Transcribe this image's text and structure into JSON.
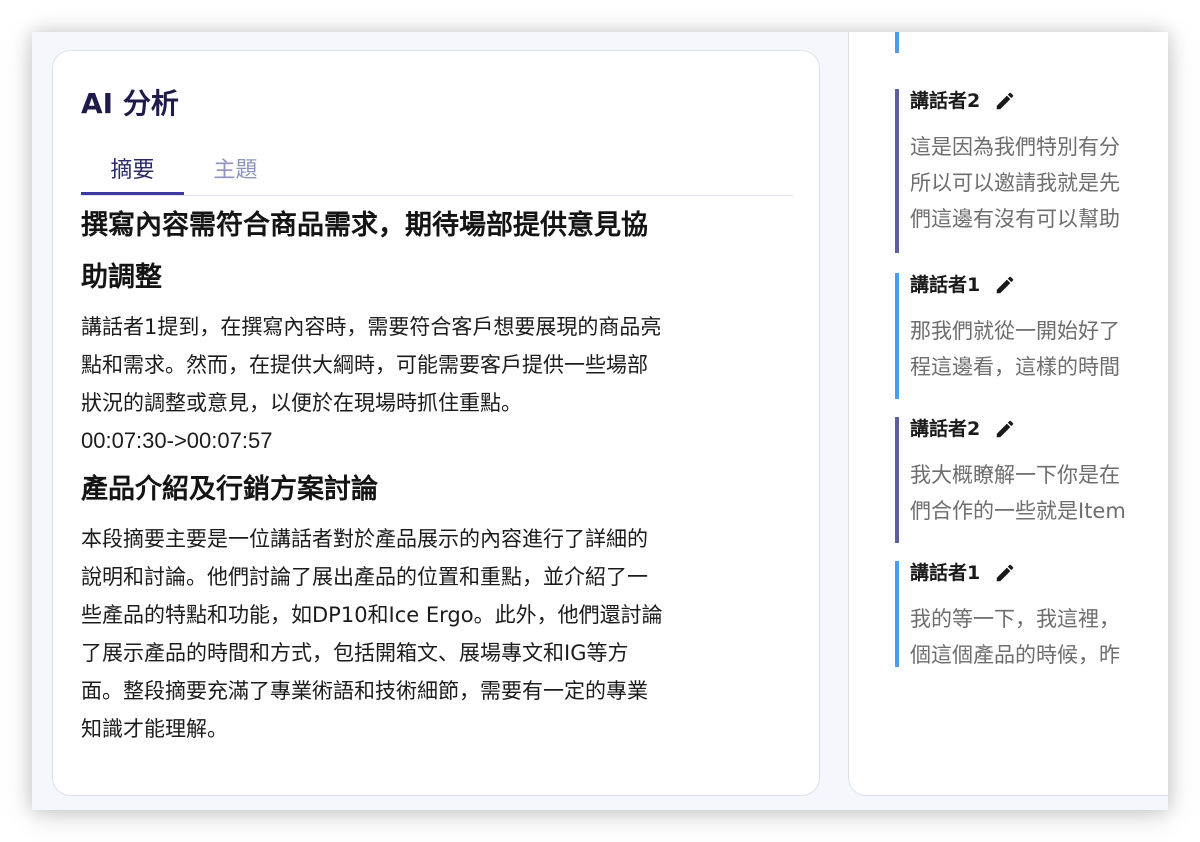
{
  "ai_panel": {
    "title": "AI 分析",
    "tabs": [
      {
        "label": "摘要",
        "active": true
      },
      {
        "label": "主題",
        "active": false
      }
    ],
    "sections": [
      {
        "title_lines": [
          "撰寫內容需符合商品需求，期待場部提供意見協",
          "助調整"
        ],
        "text_lines": [
          "講話者1提到，在撰寫內容時，需要符合客戶想要展現的商品亮",
          "點和需求。然而，在提供大綱時，可能需要客戶提供一些場部",
          "狀況的調整或意見，以便於在現場時抓住重點。"
        ],
        "timecode": "00:07:30->00:07:57"
      },
      {
        "title_lines": [
          "產品介紹及行銷方案討論"
        ],
        "text_lines": [
          "本段摘要主要是一位講話者對於產品展示的內容進行了詳細的",
          "說明和討論。他們討論了展出產品的位置和重點，並介紹了一",
          "些產品的特點和功能，如DP10和Ice Ergo。此外，他們還討論",
          "了展示產品的時間和方式，包括開箱文、展場專文和IG等方",
          "面。整段摘要充滿了專業術語和技術細節，需要有一定的專業",
          "知識才能理解。"
        ]
      }
    ]
  },
  "transcript": {
    "entries": [
      {
        "speaker": "講話者2",
        "lines": [
          "這是因為我們特別有分",
          "所以可以邀請我就是先",
          "們這邊有沒有可以幫助"
        ]
      },
      {
        "speaker": "講話者1",
        "lines": [
          "那我們就從一開始好了",
          "程這邊看，這樣的時間"
        ]
      },
      {
        "speaker": "講話者2",
        "lines": [
          "我大概瞭解一下你是在",
          "們合作的一些就是Item"
        ]
      },
      {
        "speaker": "講話者1",
        "lines": [
          "我的等一下，我這裡，",
          "個這個產品的時候，昨"
        ]
      }
    ]
  },
  "colors": {
    "speaker1_bar": "#4a9ee8",
    "speaker2_bar": "#5d5fa0",
    "active_tab": "#2b2a6c",
    "inactive_tab": "#8f93bf",
    "title": "#1e1b4b"
  },
  "icons": {
    "edit": "pencil-icon"
  }
}
